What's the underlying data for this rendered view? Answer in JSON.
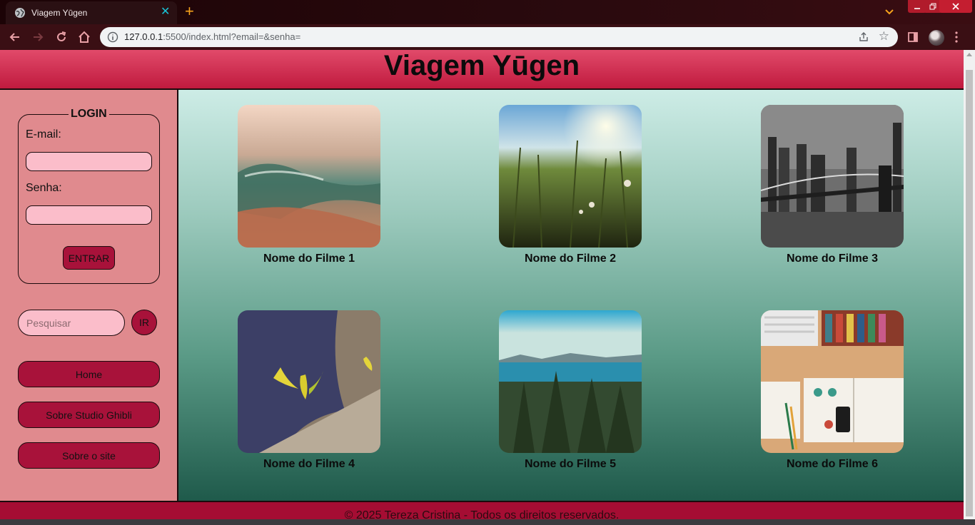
{
  "browser": {
    "tab_title": "Viagem Yūgen",
    "tab_close": "✕",
    "new_tab": "+",
    "url_host": "127.0.0.1",
    "url_rest": ":5500/index.html?email=&senha="
  },
  "header": {
    "title": "Viagem Yūgen"
  },
  "sidebar": {
    "login": {
      "legend": "LOGIN",
      "email_label": "E-mail:",
      "email_value": "",
      "password_label": "Senha:",
      "password_value": "",
      "submit_label": "ENTRAR"
    },
    "search": {
      "placeholder": "Pesquisar",
      "button_label": "IR"
    },
    "nav": [
      {
        "label": "Home"
      },
      {
        "label": "Sobre Studio Ghibli"
      },
      {
        "label": "Sobre o site"
      }
    ]
  },
  "gallery": [
    {
      "caption": "Nome do Filme 1",
      "image": "ocean-wave-sunset"
    },
    {
      "caption": "Nome do Filme 2",
      "image": "grass-field-sunlight"
    },
    {
      "caption": "Nome do Filme 3",
      "image": "brooklyn-bridge-night"
    },
    {
      "caption": "Nome do Filme 4",
      "image": "yellow-flower-on-log"
    },
    {
      "caption": "Nome do Filme 5",
      "image": "forest-lake-view"
    },
    {
      "caption": "Nome do Filme 6",
      "image": "desk-books-phone"
    }
  ],
  "footer": {
    "text": "© 2025 Tereza Cristina - Todos os direitos reservados."
  },
  "colors": {
    "header": "#c01a3e",
    "sidebar": "#e08a8e",
    "button": "#a8123a",
    "footer": "#a50d33"
  }
}
